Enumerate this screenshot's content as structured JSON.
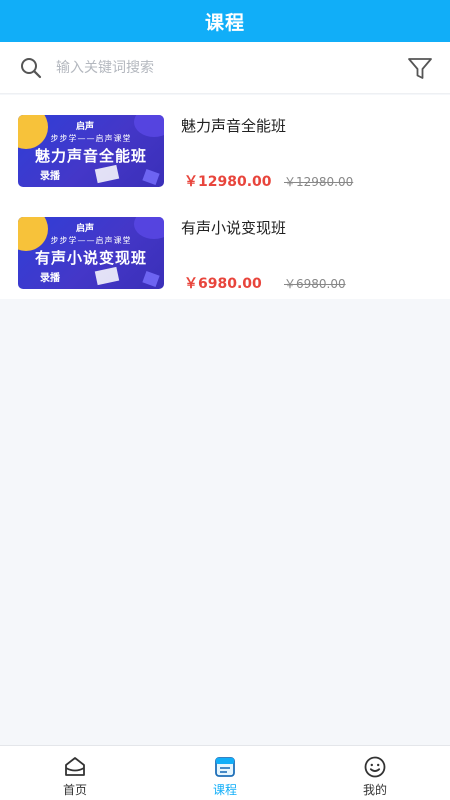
{
  "header": {
    "title": "课程"
  },
  "search": {
    "placeholder": "输入关键词搜索"
  },
  "courses": [
    {
      "thumb": {
        "logo": "启声",
        "tagline": "步步学——启声课堂",
        "headline": "魅力声音全能班",
        "tag": "录播"
      },
      "title": "魅力声音全能班",
      "price": "￥12980.00",
      "original_price": "￥12980.00"
    },
    {
      "thumb": {
        "logo": "启声",
        "tagline": "步步学——启声课堂",
        "headline": "有声小说变现班",
        "tag": "录播"
      },
      "title": "有声小说变现班",
      "price": "￥6980.00",
      "original_price": "￥6980.00"
    }
  ],
  "tabbar": {
    "items": [
      {
        "label": "首页",
        "icon": "home-icon"
      },
      {
        "label": "课程",
        "icon": "course-icon",
        "active": true
      },
      {
        "label": "我的",
        "icon": "smile-icon"
      }
    ]
  },
  "colors": {
    "accent": "#11aef8",
    "price": "#e8453c"
  }
}
